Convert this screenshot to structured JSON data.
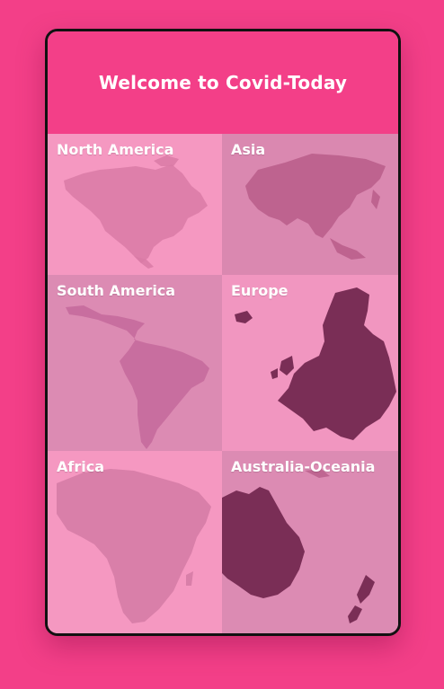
{
  "header": {
    "title": "Welcome to Covid-Today"
  },
  "regions": [
    {
      "label": "North America",
      "icon": "north-america-map"
    },
    {
      "label": "Asia",
      "icon": "asia-map"
    },
    {
      "label": "South America",
      "icon": "south-america-map"
    },
    {
      "label": "Europe",
      "icon": "europe-map"
    },
    {
      "label": "Africa",
      "icon": "africa-map"
    },
    {
      "label": "Australia-Oceania",
      "icon": "oceania-map"
    }
  ],
  "colors": {
    "background": "#f33f88",
    "header": "#f33f88",
    "tile_light": "#f598c1",
    "tile_dark": "#da88b0",
    "map_fill_light": "#c96b98",
    "map_fill_dark": "#7a2e56"
  }
}
